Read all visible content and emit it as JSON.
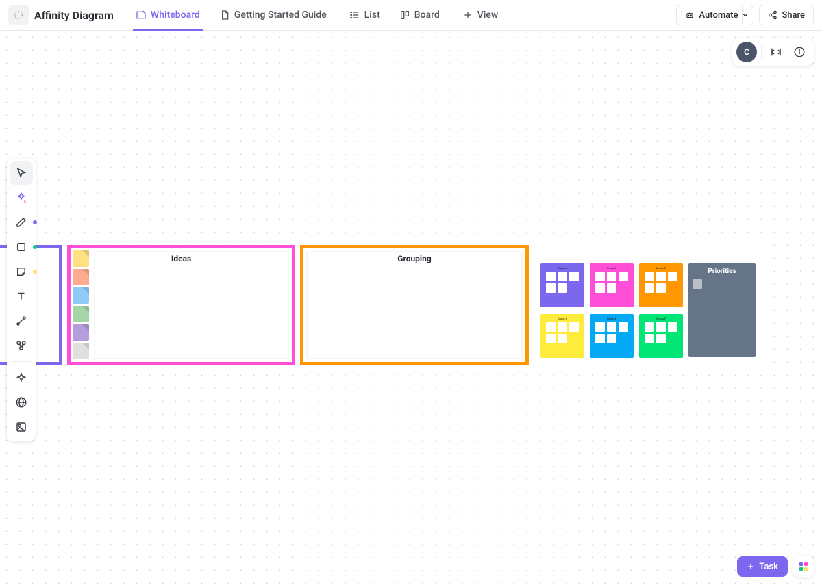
{
  "doc": {
    "title": "Affinity Diagram"
  },
  "tabs": [
    {
      "label": "Whiteboard",
      "icon": "whiteboard-icon"
    },
    {
      "label": "Getting Started Guide",
      "icon": "doc-icon"
    },
    {
      "label": "List",
      "icon": "list-icon"
    },
    {
      "label": "Board",
      "icon": "board-icon"
    }
  ],
  "view_tab": {
    "label": "View"
  },
  "topbar_buttons": {
    "automate": "Automate",
    "share": "Share"
  },
  "avatar_initial": "C",
  "task_button": "Task",
  "content": {
    "ideas_title": "Ideas",
    "grouping_title": "Grouping",
    "priorities_title": "Priorities",
    "sticky_colors": [
      "#ffe082",
      "#ffab91",
      "#90caf9",
      "#a5d6a7",
      "#b39ddb",
      "#e0e0e0"
    ],
    "summary_cards": [
      {
        "color": "#7b68ee",
        "label": "Group A"
      },
      {
        "color": "#ff4fd8",
        "label": "Group B"
      },
      {
        "color": "#ff9800",
        "label": "Group C"
      },
      {
        "color": "#ffeb3b",
        "label": "Group D"
      },
      {
        "color": "#03a9f4",
        "label": "Group E"
      },
      {
        "color": "#00e676",
        "label": "Group F"
      }
    ]
  },
  "apps_colors": [
    "#7b68ee",
    "#ff4fd8",
    "#00d084",
    "#ffde5c"
  ]
}
